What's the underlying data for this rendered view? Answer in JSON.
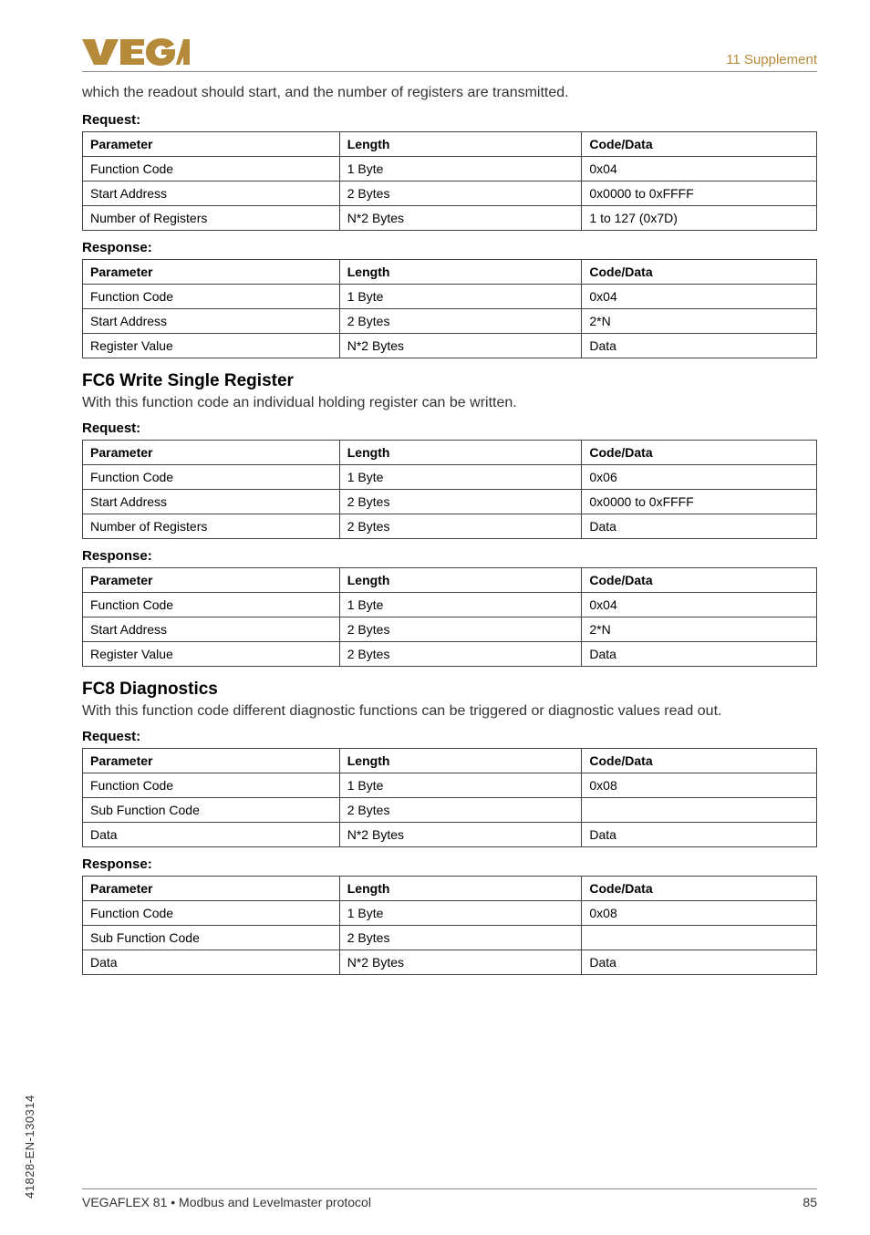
{
  "header": {
    "supplement": "11 Supplement"
  },
  "intro": "which the readout should start, and the number of registers are transmitted.",
  "table_headers": {
    "parameter": "Parameter",
    "length": "Length",
    "code": "Code/Data"
  },
  "labels": {
    "request": "Request:",
    "response": "Response:"
  },
  "sections": [
    {
      "title": null,
      "desc": null,
      "request": [
        {
          "param": "Function Code",
          "length": "1 Byte",
          "code": "0x04"
        },
        {
          "param": "Start Address",
          "length": "2 Bytes",
          "code": "0x0000 to 0xFFFF"
        },
        {
          "param": "Number of Registers",
          "length": "N*2 Bytes",
          "code": "1 to 127 (0x7D)"
        }
      ],
      "response": [
        {
          "param": "Function Code",
          "length": "1 Byte",
          "code": "0x04"
        },
        {
          "param": "Start Address",
          "length": "2 Bytes",
          "code": "2*N"
        },
        {
          "param": "Register Value",
          "length": "N*2 Bytes",
          "code": "Data"
        }
      ]
    },
    {
      "title": "FC6 Write Single Register",
      "desc": "With this function code an individual holding register can be written.",
      "request": [
        {
          "param": "Function Code",
          "length": "1 Byte",
          "code": "0x06"
        },
        {
          "param": "Start Address",
          "length": "2 Bytes",
          "code": "0x0000 to 0xFFFF"
        },
        {
          "param": "Number of Registers",
          "length": "2 Bytes",
          "code": "Data"
        }
      ],
      "response": [
        {
          "param": "Function Code",
          "length": "1 Byte",
          "code": "0x04"
        },
        {
          "param": "Start Address",
          "length": "2 Bytes",
          "code": "2*N"
        },
        {
          "param": "Register Value",
          "length": "2 Bytes",
          "code": "Data"
        }
      ]
    },
    {
      "title": "FC8 Diagnostics",
      "desc": "With this function code different diagnostic functions can be triggered or diagnostic values read out.",
      "request": [
        {
          "param": "Function Code",
          "length": "1 Byte",
          "code": "0x08"
        },
        {
          "param": "Sub Function Code",
          "length": "2 Bytes",
          "code": ""
        },
        {
          "param": "Data",
          "length": "N*2 Bytes",
          "code": "Data"
        }
      ],
      "response": [
        {
          "param": "Function Code",
          "length": "1 Byte",
          "code": "0x08"
        },
        {
          "param": "Sub Function Code",
          "length": "2 Bytes",
          "code": ""
        },
        {
          "param": "Data",
          "length": "N*2 Bytes",
          "code": "Data"
        }
      ]
    }
  ],
  "footer": {
    "left": "VEGAFLEX 81 • Modbus and Levelmaster protocol",
    "right": "85"
  },
  "side_doc": "41828-EN-130314"
}
